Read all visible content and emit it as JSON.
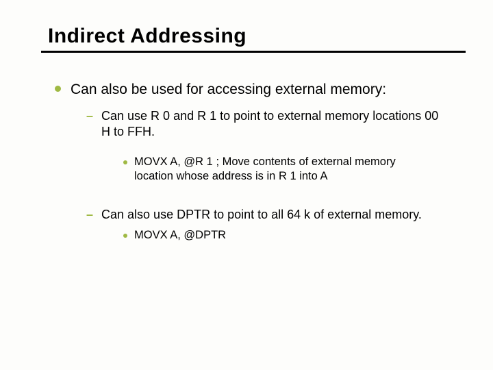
{
  "title": "Indirect Addressing",
  "l1": "Can also be used for accessing external memory:",
  "l2a": "Can use R 0 and R 1 to point to external memory locations 00 H to FFH.",
  "l3a": "MOVX A, @R 1 ; Move contents of external memory location whose address is in R 1 into A",
  "l2b": "Can also use DPTR to point to all 64 k of external memory.",
  "l3b": "MOVX A, @DPTR"
}
